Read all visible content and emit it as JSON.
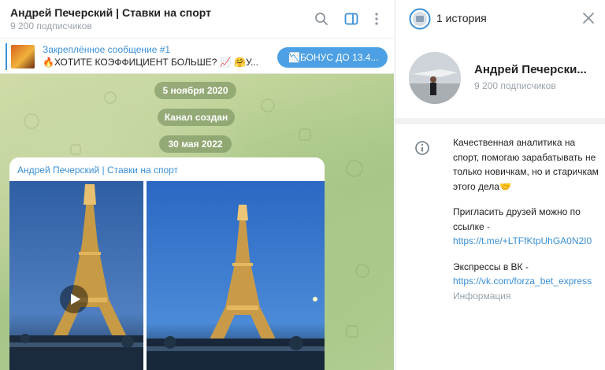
{
  "channel": {
    "title": "Андрей Печерский | Ставки на спорт",
    "subscribers": "9 200 подписчиков"
  },
  "pinned": {
    "title": "Закреплённое сообщение #1",
    "text": "🔥ХОТИТЕ КОЭФФИЦИЕНТ БОЛЬШЕ? 📈 🤗У...",
    "button": "📉БОНУС ДО 13.4..."
  },
  "chat": {
    "date_pills": [
      "5 ноября 2020",
      "Канал создан",
      "30 мая 2022"
    ],
    "message_author": "Андрей Печерский | Ставки на спорт"
  },
  "right_panel": {
    "stories_label": "1 история",
    "profile_name": "Андрей Печерски...",
    "profile_subscribers": "9 200 подписчиков",
    "about": {
      "text1": "Качественная аналитика на спорт, помогаю зарабатывать не только новичкам, но и старичкам этого дела🤝",
      "text2": "Пригласить друзей можно по ссылке -",
      "link1": "https://t.me/+LTFfKtpUhGA0N2I0",
      "text3": "Экспрессы в ВК -",
      "link2": "https://vk.com/forza_bet_express",
      "label": "Информация"
    }
  },
  "colors": {
    "accent": "#3a8fd6",
    "muted": "#9aa3ab",
    "button": "#4da0e3"
  }
}
